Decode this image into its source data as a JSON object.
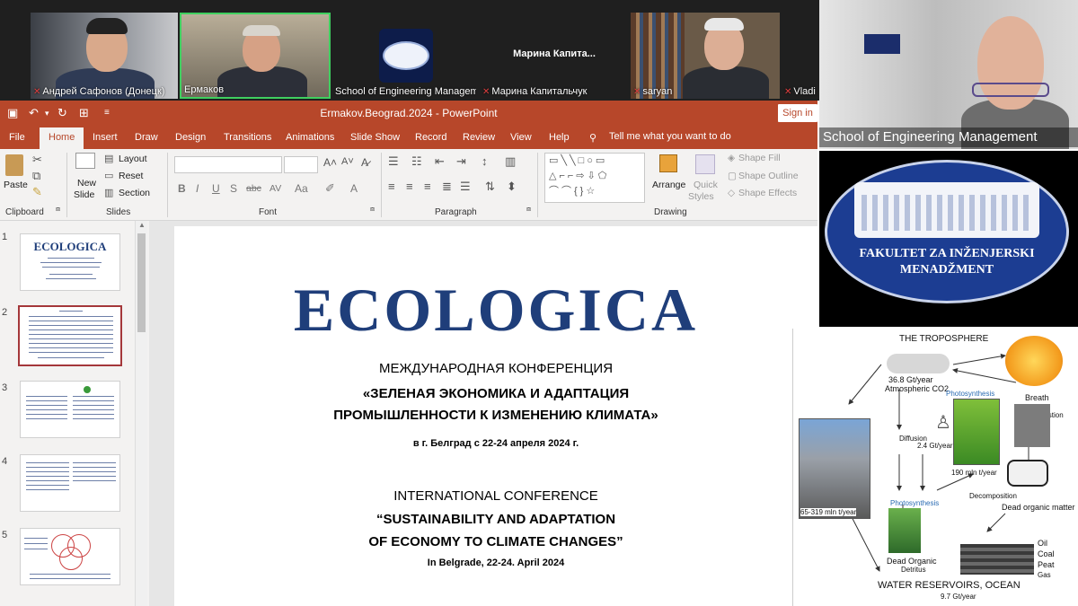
{
  "participants": [
    {
      "name": "Андрей Сафонов (Донецк)",
      "muted": true
    },
    {
      "name": "Ермаков",
      "muted": false,
      "active": true
    },
    {
      "name": "School of Engineering Management",
      "muted": false
    },
    {
      "name": "Марина Капитальчук",
      "header": "Марина Капита...",
      "muted": true
    },
    {
      "name": "saryan",
      "muted": true
    },
    {
      "name": "Vladi",
      "muted": true
    }
  ],
  "titlebar": {
    "title": "Ermakov.Beograd.2024 - PowerPoint",
    "sign_in": "Sign in",
    "icons": [
      "save-icon",
      "undo-icon",
      "redo-icon",
      "present-icon",
      "customize-icon"
    ]
  },
  "menu": {
    "items": [
      "File",
      "Home",
      "Insert",
      "Draw",
      "Design",
      "Transitions",
      "Animations",
      "Slide Show",
      "Record",
      "Review",
      "View",
      "Help"
    ],
    "active": "Home",
    "tell_me": "Tell me what you want to do"
  },
  "ribbon": {
    "clipboard": {
      "label": "Clipboard",
      "paste": "Paste"
    },
    "slides": {
      "label": "Slides",
      "new_slide_1": "New",
      "new_slide_2": "Slide",
      "layout": "Layout",
      "reset": "Reset",
      "section": "Section"
    },
    "font": {
      "label": "Font",
      "bold": "B",
      "italic": "I",
      "underline": "U",
      "shadow": "S",
      "strike": "abc",
      "spacing": "AV",
      "case": "Aa",
      "color": "A"
    },
    "paragraph": {
      "label": "Paragraph"
    },
    "drawing": {
      "label": "Drawing",
      "arrange": "Arrange",
      "quick_styles_1": "Quick",
      "quick_styles_2": "Styles",
      "shape_fill": "Shape Fill",
      "shape_outline": "Shape Outline",
      "shape_effects": "Shape Effects"
    }
  },
  "thumbnails": [
    {
      "num": "1",
      "title": "ECOLOGICA"
    },
    {
      "num": "2",
      "selected": true
    },
    {
      "num": "3"
    },
    {
      "num": "4"
    },
    {
      "num": "5"
    }
  ],
  "slide": {
    "logo": "ECOLOGICA",
    "ru_heading": "МЕЖДУНАРОДНАЯ КОНФЕРЕНЦИЯ",
    "ru_title_1": "«ЗЕЛЕНАЯ ЭКОНОМИКА И АДАПТАЦИЯ",
    "ru_title_2": "ПРОМЫШЛЕННОСТИ К ИЗМЕНЕНИЮ КЛИМАТА»",
    "ru_place": "в г. Белград с 22-24 апреля 2024 г.",
    "en_heading": "INTERNATIONAL CONFERENCE",
    "en_title_1": "“SUSTAINABILITY AND ADAPTATION",
    "en_title_2": "OF ECONOMY TO CLIMATE CHANGES”",
    "en_place": "In Belgrade, 22-24. April 2024"
  },
  "right": {
    "speaker_name": "School of Engineering Management",
    "logo_line_1": "FAKULTET ZA INŽENJERSKI",
    "logo_line_2": "MENADŽMENT",
    "diagram": {
      "title": "THE TROPOSPHERE",
      "atm_value": "36.8 Gt/year",
      "atm_label": "Atmospheric CO2",
      "photosynthesis": "Photosynthesis",
      "breath": "Breath",
      "combustion": "Combustion",
      "diffusion": "Diffusion",
      "diffusion_value": "2.4 Gt/year",
      "plants_value": "190 mln t/year",
      "volcano_value": "65-319 mln t/year",
      "decomposition": "Decomposition",
      "photosynthesis_2": "Photosynthesis",
      "dead_matter": "Dead organic matter",
      "dead_organic": "Dead Organic",
      "detritus": "Detritus",
      "oil": "Oil",
      "coal": "Coal",
      "peat": "Peat",
      "gas": "Gas",
      "reservoirs": "WATER RESERVOIRS, OCEAN",
      "ocean_value": "9.7 Gt/year"
    }
  }
}
